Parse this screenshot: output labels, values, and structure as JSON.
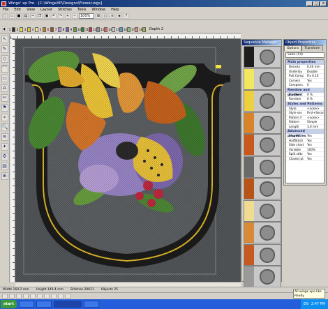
{
  "window": {
    "title": "Wings' xp Pro - [C:\\WingsXP\\Designs\\Flower.wgs]",
    "min": "_",
    "max": "□",
    "close": "✕"
  },
  "menu": [
    "File",
    "Edit",
    "View",
    "Layout",
    "Stitches",
    "Tools",
    "Window",
    "Help"
  ],
  "toolbar": {
    "zoom": "100%",
    "depth": "Depth 2"
  },
  "color_swatches": [
    {
      "n": "1",
      "c": "#2a2a2a"
    },
    {
      "n": "2",
      "c": "#f0e040"
    },
    {
      "n": "3",
      "c": "#e8c030"
    },
    {
      "n": "4",
      "c": "#f5e8a0"
    },
    {
      "n": "5",
      "c": "#d07820"
    },
    {
      "n": "6",
      "c": "#a84820"
    },
    {
      "n": "7",
      "c": "#c090e0"
    },
    {
      "n": "8",
      "c": "#7060b0"
    },
    {
      "n": "9",
      "c": "#60a040"
    },
    {
      "n": "10",
      "c": "#3a7a30"
    },
    {
      "n": "11",
      "c": "#c03050"
    },
    {
      "n": "12",
      "c": "#909090"
    },
    {
      "n": "13",
      "c": "#f06060"
    },
    {
      "n": "14",
      "c": "#d0d0d0"
    },
    {
      "n": "15",
      "c": "#50a0d0"
    },
    {
      "n": "16",
      "c": "#80c080"
    },
    {
      "n": "17",
      "c": "#e09070"
    },
    {
      "n": "18",
      "c": "#b0b040"
    }
  ],
  "left_tools": [
    "↖",
    "✎",
    "◇",
    "⌒",
    "▭",
    "A",
    "✂",
    "⚑",
    "⌖",
    "🔍",
    "≋",
    "✦",
    "⚙",
    "▤",
    "⊞"
  ],
  "sequence_manager": {
    "title": "Sequence Manager",
    "items": [
      {
        "color": "#1e1e1e"
      },
      {
        "color": "#f2e860"
      },
      {
        "color": "#ecd040"
      },
      {
        "color": "#d8842a"
      },
      {
        "color": "#c8581c"
      },
      {
        "color": "#6a6a6a"
      },
      {
        "color": "#b85418"
      },
      {
        "color": "#f0dc90"
      },
      {
        "color": "#d88a3a"
      },
      {
        "color": "#c45a22"
      },
      {
        "color": "#9a9a9a"
      }
    ]
  },
  "object_properties": {
    "title": "Object Properties",
    "tabs": [
      "Options",
      "Transform"
    ],
    "select": "Satin (F4)",
    "sections": [
      {
        "name": "Main properties",
        "rows": [
          [
            "Density",
            "0.40 mm"
          ],
          [
            "Underlay",
            "Double"
          ],
          [
            "Pull.Comp",
            "Fix 0.10"
          ],
          [
            "Corners",
            "Yes"
          ],
          [
            "Compens.",
            "0"
          ]
        ]
      },
      {
        "name": "Random and gradient",
        "rows": [
          [
            "Random",
            "0 %"
          ],
          [
            "Random",
            "0 %"
          ]
        ]
      },
      {
        "name": "Styles and Patterns",
        "rows": [
          [
            "Style",
            "<none>"
          ],
          [
            "Style sec",
            "First+Second"
          ],
          [
            "Pattern F",
            "<none>"
          ],
          [
            "Pattern",
            "Simple"
          ],
          [
            "Length",
            "3.0 mm"
          ]
        ]
      },
      {
        "name": "Advanced properties",
        "rows": [
          [
            "ShortSt",
            "Yes"
          ],
          [
            "HalfStitch",
            "Yes"
          ],
          [
            "Side chart",
            "Yes"
          ],
          [
            "Variable",
            "100%"
          ],
          [
            "Split stitc",
            "Yes"
          ],
          [
            "Closest pt",
            "Yes"
          ]
        ]
      }
    ]
  },
  "status": {
    "width": "Width 160.2 mm",
    "height": "Height 149.4 mm",
    "stitches": "Stitches 20611",
    "objects": "Objects 25"
  },
  "taskbar": {
    "start": "start",
    "lang": "EN",
    "time": "2:47 PM"
  },
  "tooltip": {
    "line1": "All wings xpo like",
    "line2": "Ready"
  }
}
